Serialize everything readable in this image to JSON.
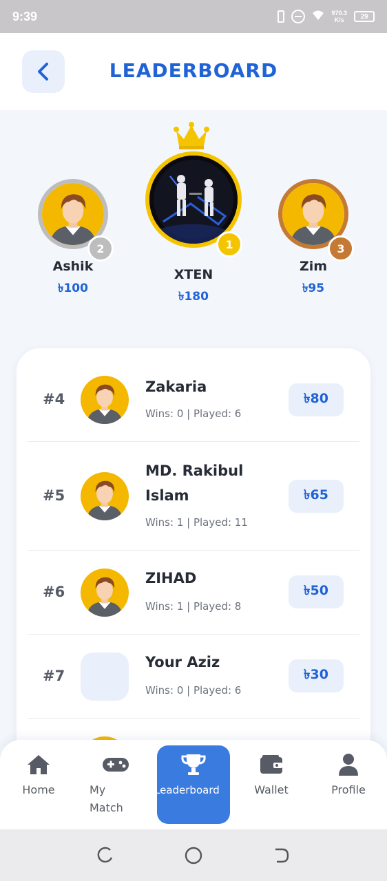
{
  "status_bar": {
    "time": "9:39",
    "net_speed": "970.3",
    "net_unit": "K/s",
    "battery": "29"
  },
  "header": {
    "title": "LEADERBOARD"
  },
  "colors": {
    "accent": "#1f63d6",
    "active_tab": "#3a7be0",
    "gold": "#f5c400",
    "silver": "#bdbdbd",
    "bronze": "#c47a34"
  },
  "podium": [
    {
      "rank": "2",
      "name": "Ashik",
      "prize": "৳100"
    },
    {
      "rank": "1",
      "name": "XTEN",
      "prize": "৳180"
    },
    {
      "rank": "3",
      "name": "Zim",
      "prize": "৳95"
    }
  ],
  "leaderboard": [
    {
      "rank": "#4",
      "name": "Zakaria",
      "stats": "Wins: 0 | Played: 6",
      "prize": "৳80"
    },
    {
      "rank": "#5",
      "name": "MD. Rakibul Islam",
      "stats": "Wins: 1 | Played: 11",
      "prize": "৳65"
    },
    {
      "rank": "#6",
      "name": "ZIHAD",
      "stats": "Wins: 1 | Played: 8",
      "prize": "৳50"
    },
    {
      "rank": "#7",
      "name": "Your Aziz",
      "stats": "Wins: 0 | Played: 6",
      "prize": "৳30"
    }
  ],
  "bottom_nav": [
    {
      "label": "Home",
      "icon": "home-icon"
    },
    {
      "label": "My Match",
      "icon": "gamepad-icon"
    },
    {
      "label": "Leaderboard",
      "icon": "trophy-icon"
    },
    {
      "label": "Wallet",
      "icon": "wallet-icon"
    },
    {
      "label": "Profile",
      "icon": "user-icon"
    }
  ]
}
